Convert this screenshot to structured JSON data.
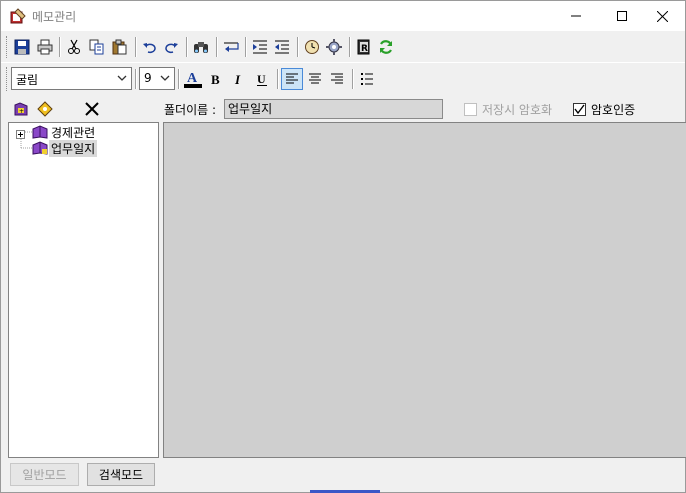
{
  "window": {
    "title": "메모관리"
  },
  "toolbar_font": {
    "font_name": "굴림",
    "font_size": "9"
  },
  "folder": {
    "label": "폴더이름 :",
    "name_value": "업무일지",
    "encrypt_on_save_label": "저장시 암호화",
    "encrypt_on_save_checked": false,
    "password_auth_label": "암호인증",
    "password_auth_checked": true
  },
  "tree": {
    "items": [
      {
        "label": "경제관련",
        "expanded": false,
        "selected": false
      },
      {
        "label": "업무일지",
        "expanded": false,
        "selected": true
      }
    ]
  },
  "editor": {
    "content": ""
  },
  "bottom": {
    "normal_mode_label": "일반모드",
    "search_mode_label": "검색모드"
  },
  "colors": {
    "editor_background": "#cfcfcf",
    "font_color_bar": "#000000",
    "refresh_green": "#2aa02a"
  }
}
